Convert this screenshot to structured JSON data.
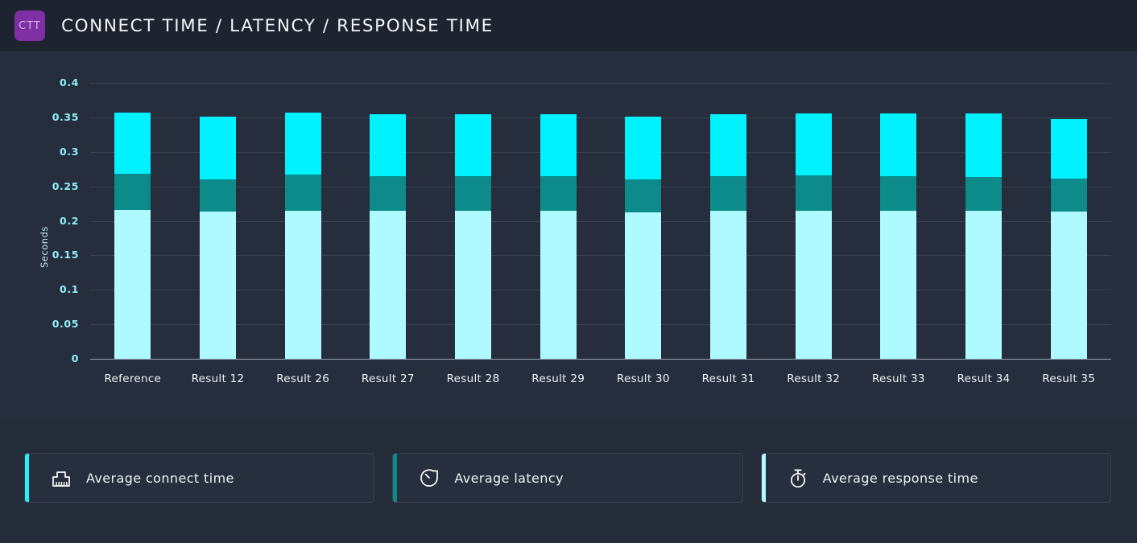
{
  "header": {
    "badge_label": "CTT",
    "badge_color": "#7d2fa3",
    "title": "CONNECT TIME / LATENCY / RESPONSE TIME"
  },
  "chart_data": {
    "type": "bar",
    "subtype": "stacked-bar",
    "title": "CONNECT TIME / LATENCY / RESPONSE TIME",
    "xlabel": "",
    "ylabel": "Seconds",
    "ylim": [
      0,
      0.4
    ],
    "grid": true,
    "legend_position": "bottom",
    "yticks": [
      "0.4",
      "0.35",
      "0.3",
      "0.25",
      "0.2",
      "0.15",
      "0.1",
      "0.05",
      "0"
    ],
    "ytick_values": [
      0.4,
      0.35,
      0.3,
      0.25,
      0.2,
      0.15,
      0.1,
      0.05,
      0
    ],
    "categories": [
      "Reference",
      "Result 12",
      "Result 26",
      "Result 27",
      "Result 28",
      "Result 29",
      "Result 30",
      "Result 31",
      "Result 32",
      "Result 33",
      "Result 34",
      "Result 35"
    ],
    "series": [
      {
        "name": "Average connect time",
        "color": "#aefaff",
        "values": [
          0.216,
          0.213,
          0.215,
          0.215,
          0.215,
          0.215,
          0.212,
          0.215,
          0.215,
          0.215,
          0.215,
          0.213
        ]
      },
      {
        "name": "Average latency",
        "color": "#0d8a8a",
        "values": [
          0.052,
          0.047,
          0.052,
          0.05,
          0.05,
          0.05,
          0.048,
          0.05,
          0.051,
          0.05,
          0.049,
          0.048
        ]
      },
      {
        "name": "Average response time",
        "color": "#00f2ff",
        "values": [
          0.089,
          0.091,
          0.09,
          0.089,
          0.09,
          0.089,
          0.091,
          0.089,
          0.09,
          0.091,
          0.092,
          0.086
        ]
      }
    ],
    "totals": [
      0.357,
      0.351,
      0.357,
      0.354,
      0.355,
      0.354,
      0.351,
      0.354,
      0.356,
      0.356,
      0.356,
      0.347
    ]
  },
  "legend": {
    "cards": [
      {
        "label": "Average connect time",
        "icon": "ethernet-port-icon",
        "accent": "#27f0f5"
      },
      {
        "label": "Average latency",
        "icon": "clock-icon",
        "accent": "#0d8a8a"
      },
      {
        "label": "Average response time",
        "icon": "stopwatch-icon",
        "accent": "#aefaff"
      }
    ]
  }
}
